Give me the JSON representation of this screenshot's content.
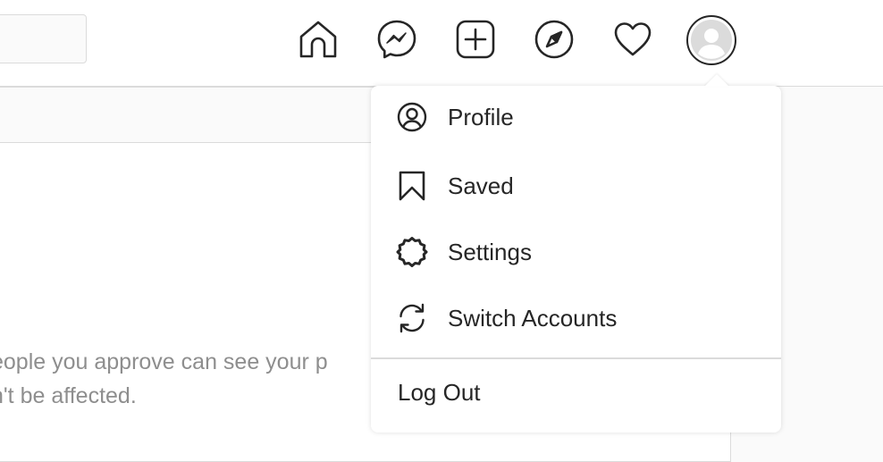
{
  "colors": {
    "text": "#262626",
    "muted": "#8e8e8e",
    "border": "#dbdbdb",
    "background": "#fafafa"
  },
  "nav": {
    "icons": [
      "home-icon",
      "messenger-icon",
      "new-post-icon",
      "explore-icon",
      "activity-heart-icon",
      "profile-avatar"
    ]
  },
  "content": {
    "privacy_line_1": "eople you approve can see your p",
    "privacy_line_2": "n't be affected."
  },
  "menu": {
    "items": [
      {
        "label": "Profile",
        "icon": "profile-icon"
      },
      {
        "label": "Saved",
        "icon": "bookmark-icon"
      },
      {
        "label": "Settings",
        "icon": "settings-gear-icon"
      },
      {
        "label": "Switch Accounts",
        "icon": "switch-accounts-icon"
      }
    ],
    "logout_label": "Log Out"
  }
}
